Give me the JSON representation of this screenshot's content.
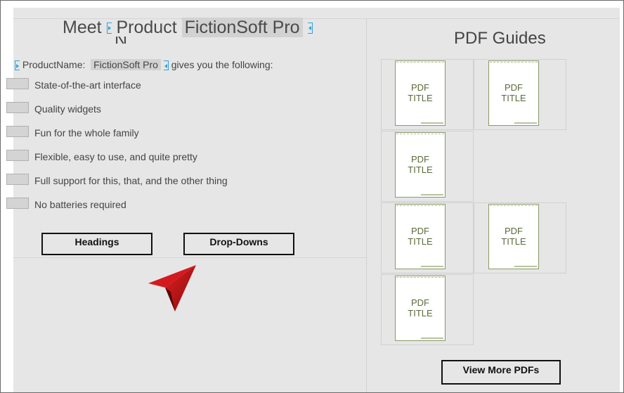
{
  "left": {
    "title_prefix": "Meet",
    "title_field": "Product",
    "title_field_overflow": "N",
    "title_value": "FictionSoft Pro",
    "intro_field": "ProductName:",
    "intro_value": "FictionSoft Pro",
    "intro_suffix": "gives you the following:",
    "features": [
      "State-of-the-art interface",
      "Quality widgets",
      "Fun for the whole family",
      "Flexible, easy to use, and quite pretty",
      "Full support for this, that, and the other thing",
      "No batteries required"
    ],
    "buttons": {
      "headings": "Headings",
      "dropdowns": "Drop-Downs"
    }
  },
  "right": {
    "heading": "PDF Guides",
    "pdf_line1": "PDF",
    "pdf_line2": "TITLE",
    "view_more": "View More PDFs"
  },
  "colors": {
    "content_control_tag": "#2fa0d8",
    "pointer": "#c8141a",
    "canvas": "#e6e6e6"
  }
}
